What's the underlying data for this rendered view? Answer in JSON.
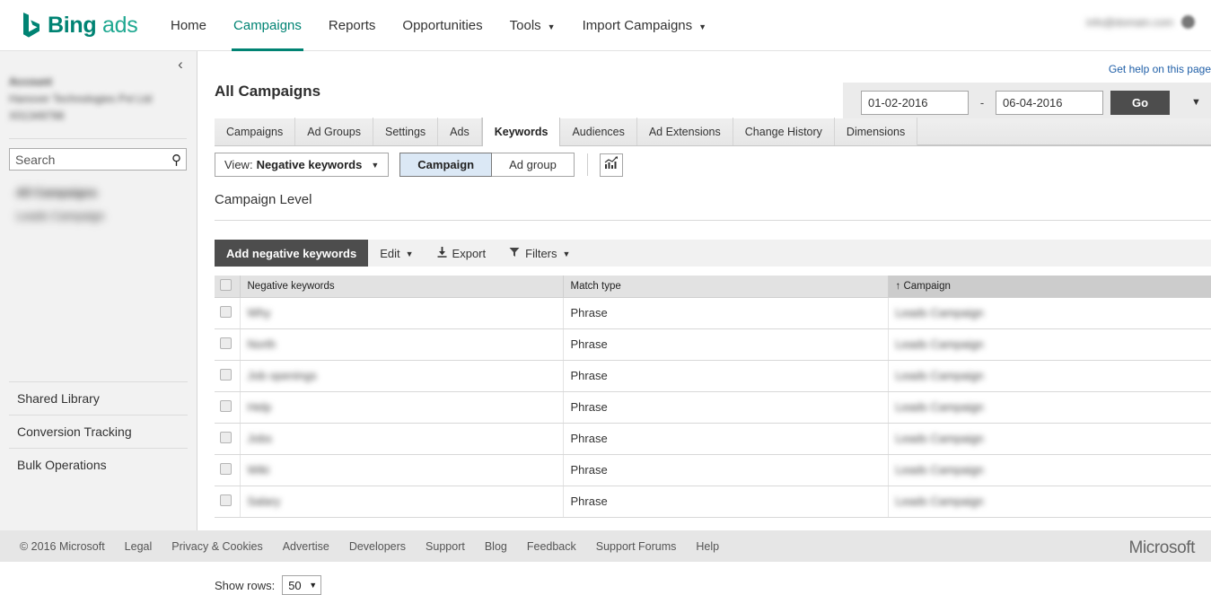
{
  "brand": {
    "logo_text_bold": "Bing",
    "logo_text_light": "ads",
    "accent_color": "#008373",
    "microsoft_logo": "Microsoft"
  },
  "topnav": {
    "items": [
      {
        "label": "Home",
        "active": false,
        "has_caret": false
      },
      {
        "label": "Campaigns",
        "active": true,
        "has_caret": false
      },
      {
        "label": "Reports",
        "active": false,
        "has_caret": false
      },
      {
        "label": "Opportunities",
        "active": false,
        "has_caret": false
      },
      {
        "label": "Tools",
        "active": false,
        "has_caret": true
      },
      {
        "label": "Import Campaigns",
        "active": false,
        "has_caret": true
      }
    ],
    "account_email": "info@domain.com",
    "avatar_icon": "user-avatar-icon"
  },
  "sidebar": {
    "collapse_icon": "chevron-left-icon",
    "account_label": "Account",
    "account_name": "Hanover Technologies Pvt Ltd",
    "account_number": "X01349798",
    "search": {
      "value": "",
      "placeholder": "Search",
      "icon": "search-icon"
    },
    "tree": [
      {
        "label": "All Campaigns",
        "bold": true
      },
      {
        "label": "Leads Campaign",
        "bold": false
      }
    ],
    "links": [
      {
        "label": "Shared Library"
      },
      {
        "label": "Conversion Tracking"
      },
      {
        "label": "Bulk Operations"
      }
    ]
  },
  "page": {
    "help_link": "Get help on this page",
    "title": "All Campaigns",
    "level_title": "Campaign Level"
  },
  "daterange": {
    "start": "01-02-2016",
    "separator": "-",
    "end": "06-04-2016",
    "go_label": "Go",
    "caret_icon": "chevron-down-icon"
  },
  "tabs": [
    {
      "label": "Campaigns",
      "active": false
    },
    {
      "label": "Ad Groups",
      "active": false
    },
    {
      "label": "Settings",
      "active": false
    },
    {
      "label": "Ads",
      "active": false
    },
    {
      "label": "Keywords",
      "active": true
    },
    {
      "label": "Audiences",
      "active": false
    },
    {
      "label": "Ad Extensions",
      "active": false
    },
    {
      "label": "Change History",
      "active": false
    },
    {
      "label": "Dimensions",
      "active": false
    }
  ],
  "viewbar": {
    "view_prefix": "View:",
    "view_value": "Negative keywords",
    "view_caret_icon": "chevron-down-icon",
    "segments": [
      {
        "label": "Campaign",
        "selected": true
      },
      {
        "label": "Ad group",
        "selected": false
      }
    ],
    "chart_toggle_icon": "bar-chart-trend-icon"
  },
  "toolbar": {
    "add_label": "Add negative keywords",
    "edit_label": "Edit",
    "export_label": "Export",
    "export_icon": "download-icon",
    "filters_label": "Filters",
    "filters_icon": "funnel-icon",
    "caret_icon": "chevron-down-icon"
  },
  "table": {
    "select_all_icon": "checkbox-unchecked-icon",
    "columns": [
      {
        "label": "Negative keywords",
        "sorted": false
      },
      {
        "label": "Match type",
        "sorted": false
      },
      {
        "label": "Campaign",
        "sorted": true,
        "sort_icon": "arrow-up-icon"
      }
    ],
    "rows": [
      {
        "keyword": "Why",
        "match_type": "Phrase",
        "campaign": "Leads Campaign"
      },
      {
        "keyword": "North",
        "match_type": "Phrase",
        "campaign": "Leads Campaign"
      },
      {
        "keyword": "Job openings",
        "match_type": "Phrase",
        "campaign": "Leads Campaign"
      },
      {
        "keyword": "Help",
        "match_type": "Phrase",
        "campaign": "Leads Campaign"
      },
      {
        "keyword": "Jobs",
        "match_type": "Phrase",
        "campaign": "Leads Campaign"
      },
      {
        "keyword": "Wiki",
        "match_type": "Phrase",
        "campaign": "Leads Campaign"
      },
      {
        "keyword": "Salary",
        "match_type": "Phrase",
        "campaign": "Leads Campaign"
      }
    ]
  },
  "showrows": {
    "label": "Show rows:",
    "value": "50",
    "caret_icon": "chevron-down-icon"
  },
  "footer": {
    "copyright": "© 2016 Microsoft",
    "links": [
      "Legal",
      "Privacy & Cookies",
      "Advertise",
      "Developers",
      "Support",
      "Blog",
      "Feedback",
      "Support Forums",
      "Help"
    ]
  }
}
